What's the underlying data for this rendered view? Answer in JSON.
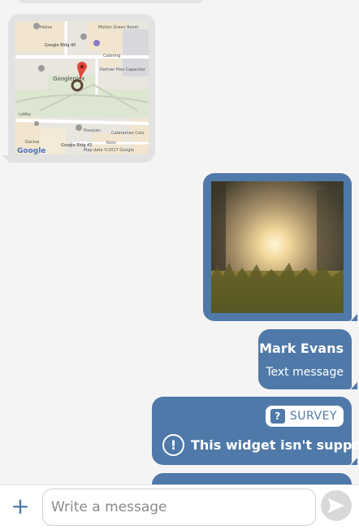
{
  "map": {
    "labels": {
      "google_bldg_40": "Google Bldg 40",
      "googleplex": "Googleplex",
      "lobby": "Lobby",
      "google_bldg_43": "Google Bldg 43",
      "charleston": "Charleston Park",
      "map_data": "Map data ©2017 Google",
      "google_logo": "Google",
      "heliport": "Helios",
      "motion": "Motion Green Room",
      "catering": "Catering",
      "partner": "Partner Plex Capacitor",
      "partner_v": "Partner Plex Spinner",
      "poveyen": "Poveyen",
      "cateraman": "Cateraman Colo",
      "gaciua": "Gaciua",
      "koso": "Koso"
    }
  },
  "contact": {
    "name": "Mark Evans",
    "subtitle": "Text message"
  },
  "survey": {
    "badge_label": "SURVEY",
    "badge_icon": "?",
    "warning_icon": "!",
    "warning_text": "This widget isn't support"
  },
  "composer": {
    "placeholder": "Write a message",
    "plus_icon": "+"
  }
}
